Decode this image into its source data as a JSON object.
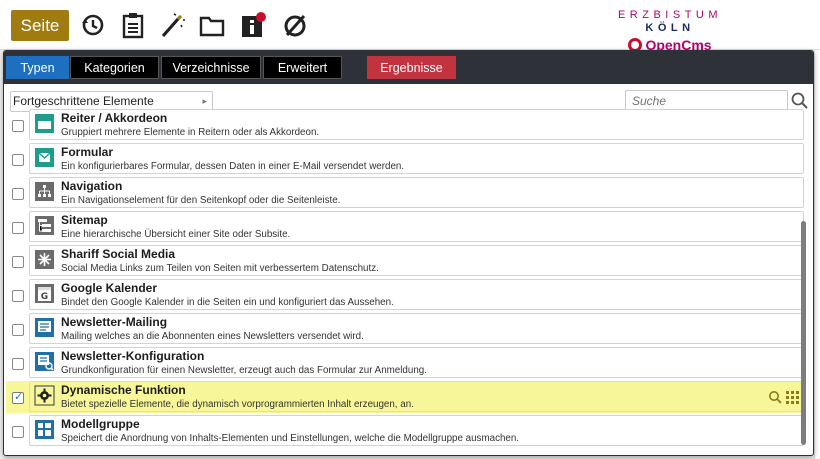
{
  "toolbar": {
    "seite_label": "Seite",
    "icons": [
      "history-icon",
      "clipboard-icon",
      "magic-wand-icon",
      "folder-icon",
      "info-icon",
      "no-visibility-icon"
    ],
    "brand_top_left": "ERZBISTUM",
    "brand_top_right": "KÖLN",
    "brand_bottom": "OpenCms"
  },
  "dialog": {
    "tabs": [
      {
        "label": "Typen",
        "active": true
      },
      {
        "label": "Kategorien"
      },
      {
        "label": "Verzeichnisse"
      },
      {
        "label": "Erweitert"
      },
      {
        "label": "Ergebnisse"
      }
    ],
    "filter": {
      "selected": "Fortgeschrittene Elemente"
    },
    "search": {
      "placeholder": "Suche",
      "value": ""
    }
  },
  "items": [
    {
      "title": "Reiter / Akkordeon",
      "desc": "Gruppiert mehrere Elemente in Reitern oder als Akkordeon.",
      "icon": "tabs-icon",
      "checked": false
    },
    {
      "title": "Formular",
      "desc": "Ein konfigurierbares Formular, dessen Daten in einer E-Mail versendet werden.",
      "icon": "form-mail-icon",
      "checked": false
    },
    {
      "title": "Navigation",
      "desc": "Ein Navigationselement für den Seitenkopf oder die Seitenleiste.",
      "icon": "sitemap-tree-icon",
      "checked": false
    },
    {
      "title": "Sitemap",
      "desc": "Eine hierarchische Übersicht einer Site oder Subsite.",
      "icon": "sitemap-icon",
      "checked": false
    },
    {
      "title": "Shariff Social Media",
      "desc": "Social Media Links zum Teilen von Seiten mit verbessertem Datenschutz.",
      "icon": "share-icon",
      "checked": false
    },
    {
      "title": "Google Kalender",
      "desc": "Bindet den Google Kalender in die Seiten ein und konfiguriert das Aussehen.",
      "icon": "calendar-icon",
      "checked": false
    },
    {
      "title": "Newsletter-Mailing",
      "desc": "Mailing welches an die Abonnenten eines Newsletters versendet wird.",
      "icon": "newsletter-icon",
      "checked": false
    },
    {
      "title": "Newsletter-Konfiguration",
      "desc": "Grundkonfiguration für einen Newsletter, erzeugt auch das Formular zur Anmeldung.",
      "icon": "newsletter-config-icon",
      "checked": false
    },
    {
      "title": "Dynamische Funktion",
      "desc": "Bietet spezielle Elemente, die dynamisch vorprogrammierten Inhalt erzeugen, an.",
      "icon": "gear-icon",
      "checked": true,
      "highlighted": true
    },
    {
      "title": "Modellgruppe",
      "desc": "Speichert die Anordnung von Inhalts-Elementen und Einstellungen, welche die Modellgruppe ausmachen.",
      "icon": "model-group-icon",
      "checked": false
    }
  ],
  "colors": {
    "seite_button": "#a07c10",
    "tab_active": "#1f6fc0",
    "tab_results": "#c0333f",
    "highlight": "#f7f79a",
    "brand_magenta": "#b3006b"
  }
}
